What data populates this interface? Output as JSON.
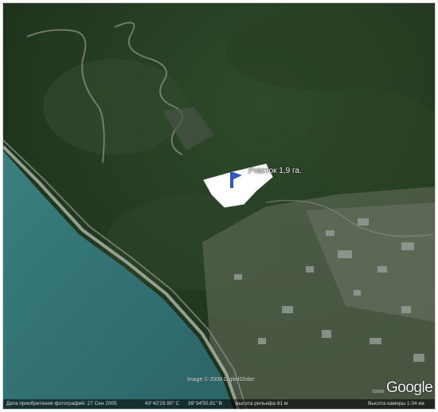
{
  "map": {
    "parcel_label": "Участок 1,9 га.",
    "imagery_credit": "Image © 2008 DigitalGlobe",
    "brand": "Google",
    "brand_year": "©2008",
    "status": {
      "date": "Дата приобретения фотографий: 27 Сен 2005",
      "lat": "43°42'29.90\" С",
      "lon": "39°34'50.81\" В",
      "elevation": "высота рельефа 81 м",
      "eye_alt": "Высота камеры 1.04 км"
    },
    "colors": {
      "sea": "#2f6f72",
      "forest": "#223a1f",
      "parcel": "#ffffff",
      "beach": "#9aa79a"
    }
  }
}
